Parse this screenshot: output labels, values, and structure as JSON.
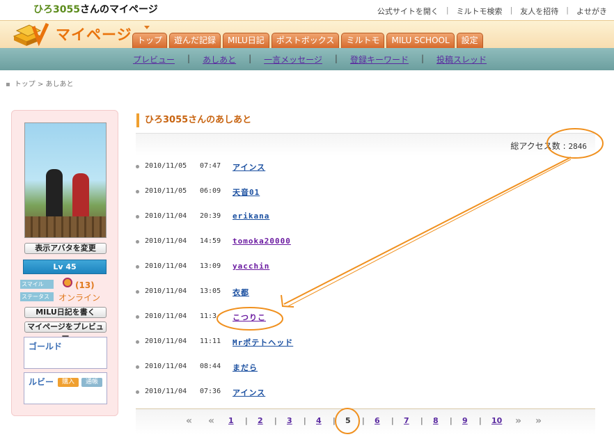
{
  "header": {
    "user_name": "ひろ3055",
    "title_suffix": "さんのマイページ",
    "links": [
      "公式サイトを開く",
      "ミルトモ検索",
      "友人を招待",
      "よせがき"
    ],
    "logo_text": "マイページ",
    "tabs": [
      "トップ",
      "遊んだ記録",
      "MILU日記",
      "ポストボックス",
      "ミルトモ",
      "MILU SCHOOL",
      "設定"
    ]
  },
  "subnav": {
    "items": [
      "プレビュー",
      "あしあと",
      "一言メッセージ",
      "登録キーワード",
      "投稿スレッド"
    ]
  },
  "breadcrumb": {
    "home": "トップ",
    "separator": ">",
    "current": "あしあと"
  },
  "sidebar": {
    "change_avatar": "表示アバタを変更",
    "level": "Lv 45",
    "smile_label": "スマイル",
    "smile_count": "(13)",
    "status_label": "ステータス",
    "status_value": "オンライン",
    "write_diary": "MILU日記を書く",
    "preview_mypage": "マイページをプレビュー",
    "gold_label": "ゴールド",
    "ruby_label": "ルビー",
    "buy_label": "購入",
    "history_label": "通帳"
  },
  "main": {
    "heading": "ひろ3055さんのあしあと",
    "access_label": "総アクセス数 :",
    "access_count": "2846",
    "visitors": [
      {
        "date": "2010/11/05",
        "time": "07:47",
        "name": "アインス"
      },
      {
        "date": "2010/11/05",
        "time": "06:09",
        "name": "天音01"
      },
      {
        "date": "2010/11/04",
        "time": "20:39",
        "name": "erikana"
      },
      {
        "date": "2010/11/04",
        "time": "14:59",
        "name": "tomoka20000"
      },
      {
        "date": "2010/11/04",
        "time": "13:09",
        "name": "yacchin"
      },
      {
        "date": "2010/11/04",
        "time": "13:05",
        "name": "衣都"
      },
      {
        "date": "2010/11/04",
        "time": "11:3",
        "name": "こつりこ"
      },
      {
        "date": "2010/11/04",
        "time": "11:11",
        "name": "Mrポテトヘッド"
      },
      {
        "date": "2010/11/04",
        "time": "08:44",
        "name": "まだら"
      },
      {
        "date": "2010/11/04",
        "time": "07:36",
        "name": "アインス"
      }
    ]
  },
  "pagination": {
    "first": "«",
    "prev": "«",
    "pages": [
      "1",
      "2",
      "3",
      "4",
      "5",
      "6",
      "7",
      "8",
      "9",
      "10"
    ],
    "current": "5",
    "next": "»",
    "last": "»"
  },
  "colors": {
    "accent_orange": "#e9730c",
    "subnav_teal": "#7aacac",
    "link_blue": "#1a4fa0",
    "link_visited": "#6a1aa0",
    "annotation": "#f0901e"
  }
}
